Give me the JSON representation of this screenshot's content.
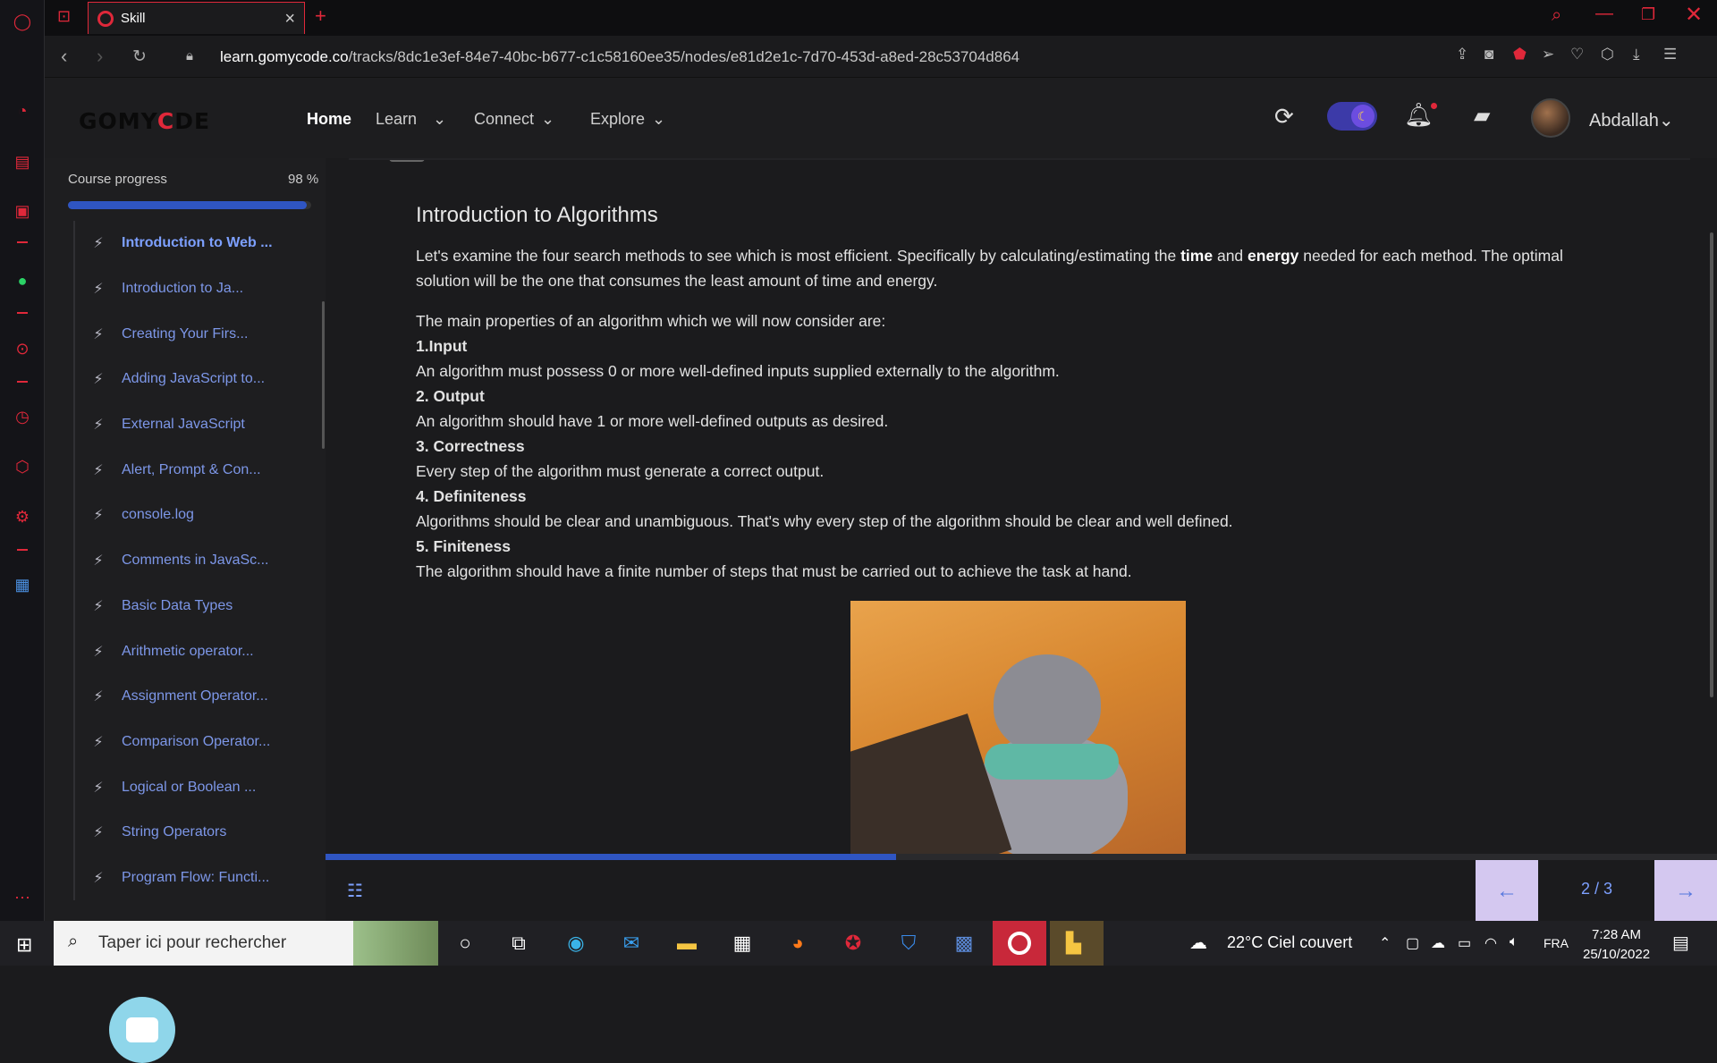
{
  "browser": {
    "tab_title": "Skill",
    "url_host": "learn.gomycode.co",
    "url_path": "/tracks/8dc1e3ef-84e7-40bc-b677-c1c58160ee35/nodes/e81d2e1c-7d70-453d-a8ed-28c53704d864"
  },
  "header": {
    "logo_pre": "GOMY",
    "logo_c": "C",
    "logo_post": "DE",
    "nav": [
      "Home",
      "Learn",
      "Connect",
      "Explore"
    ],
    "username": "Abdallah"
  },
  "course": {
    "progress_label": "Course progress",
    "progress_text": "98 %",
    "progress": 0.98,
    "lessons": [
      "Introduction to Web ...",
      "Introduction to Ja...",
      "Creating Your Firs...",
      "Adding JavaScript to...",
      "External JavaScript",
      "Alert, Prompt & Con...",
      "console.log",
      "Comments in JavaSc...",
      "Basic Data Types",
      "Arithmetic operator...",
      "Assignment Operator...",
      "Comparison Operator...",
      "Logical or Boolean ...",
      "String Operators",
      "Program Flow: Functi..."
    ]
  },
  "lesson": {
    "title": "Introduction to Algorithms",
    "intro_a": "Let's examine the four search methods to see which is most efficient. Specifically by calculating/estimating the ",
    "intro_time": "time",
    "intro_and": " and ",
    "intro_energy": "energy",
    "intro_b": " needed for each method. The optimal solution will be the one that consumes the least amount of time and energy.",
    "props_intro": "The main properties of an algorithm which we will now consider are:",
    "p1_h": "1.Input",
    "p1_t": "An algorithm must possess 0 or more well-defined inputs supplied externally to the algorithm.",
    "p2_h": "2. Output",
    "p2_t": "An algorithm should have 1 or more well-defined outputs as desired.",
    "p3_h": "3. Correctness",
    "p3_t": "Every step of the algorithm must generate a correct output.",
    "p4_h": "4. Definiteness",
    "p4_t": "Algorithms should be clear and unambiguous. That's why every step of the algorithm should be clear and well defined.",
    "p5_h": "5. Finiteness",
    "p5_t": "The algorithm should have a finite number of steps that must be carried out to achieve the task at hand."
  },
  "pager": {
    "indicator": "2 / 3",
    "slide_progress": 0.41,
    "prev": "←",
    "next": "→"
  },
  "taskbar": {
    "search_placeholder": "Taper ici pour rechercher",
    "weather": "22°C  Ciel couvert",
    "lang": "FRA",
    "time": "7:28 AM",
    "date": "25/10/2022"
  },
  "colors": {
    "accent": "#e0283a",
    "progress_blue": "#2f55c2",
    "link_blue": "#7da0ff"
  }
}
